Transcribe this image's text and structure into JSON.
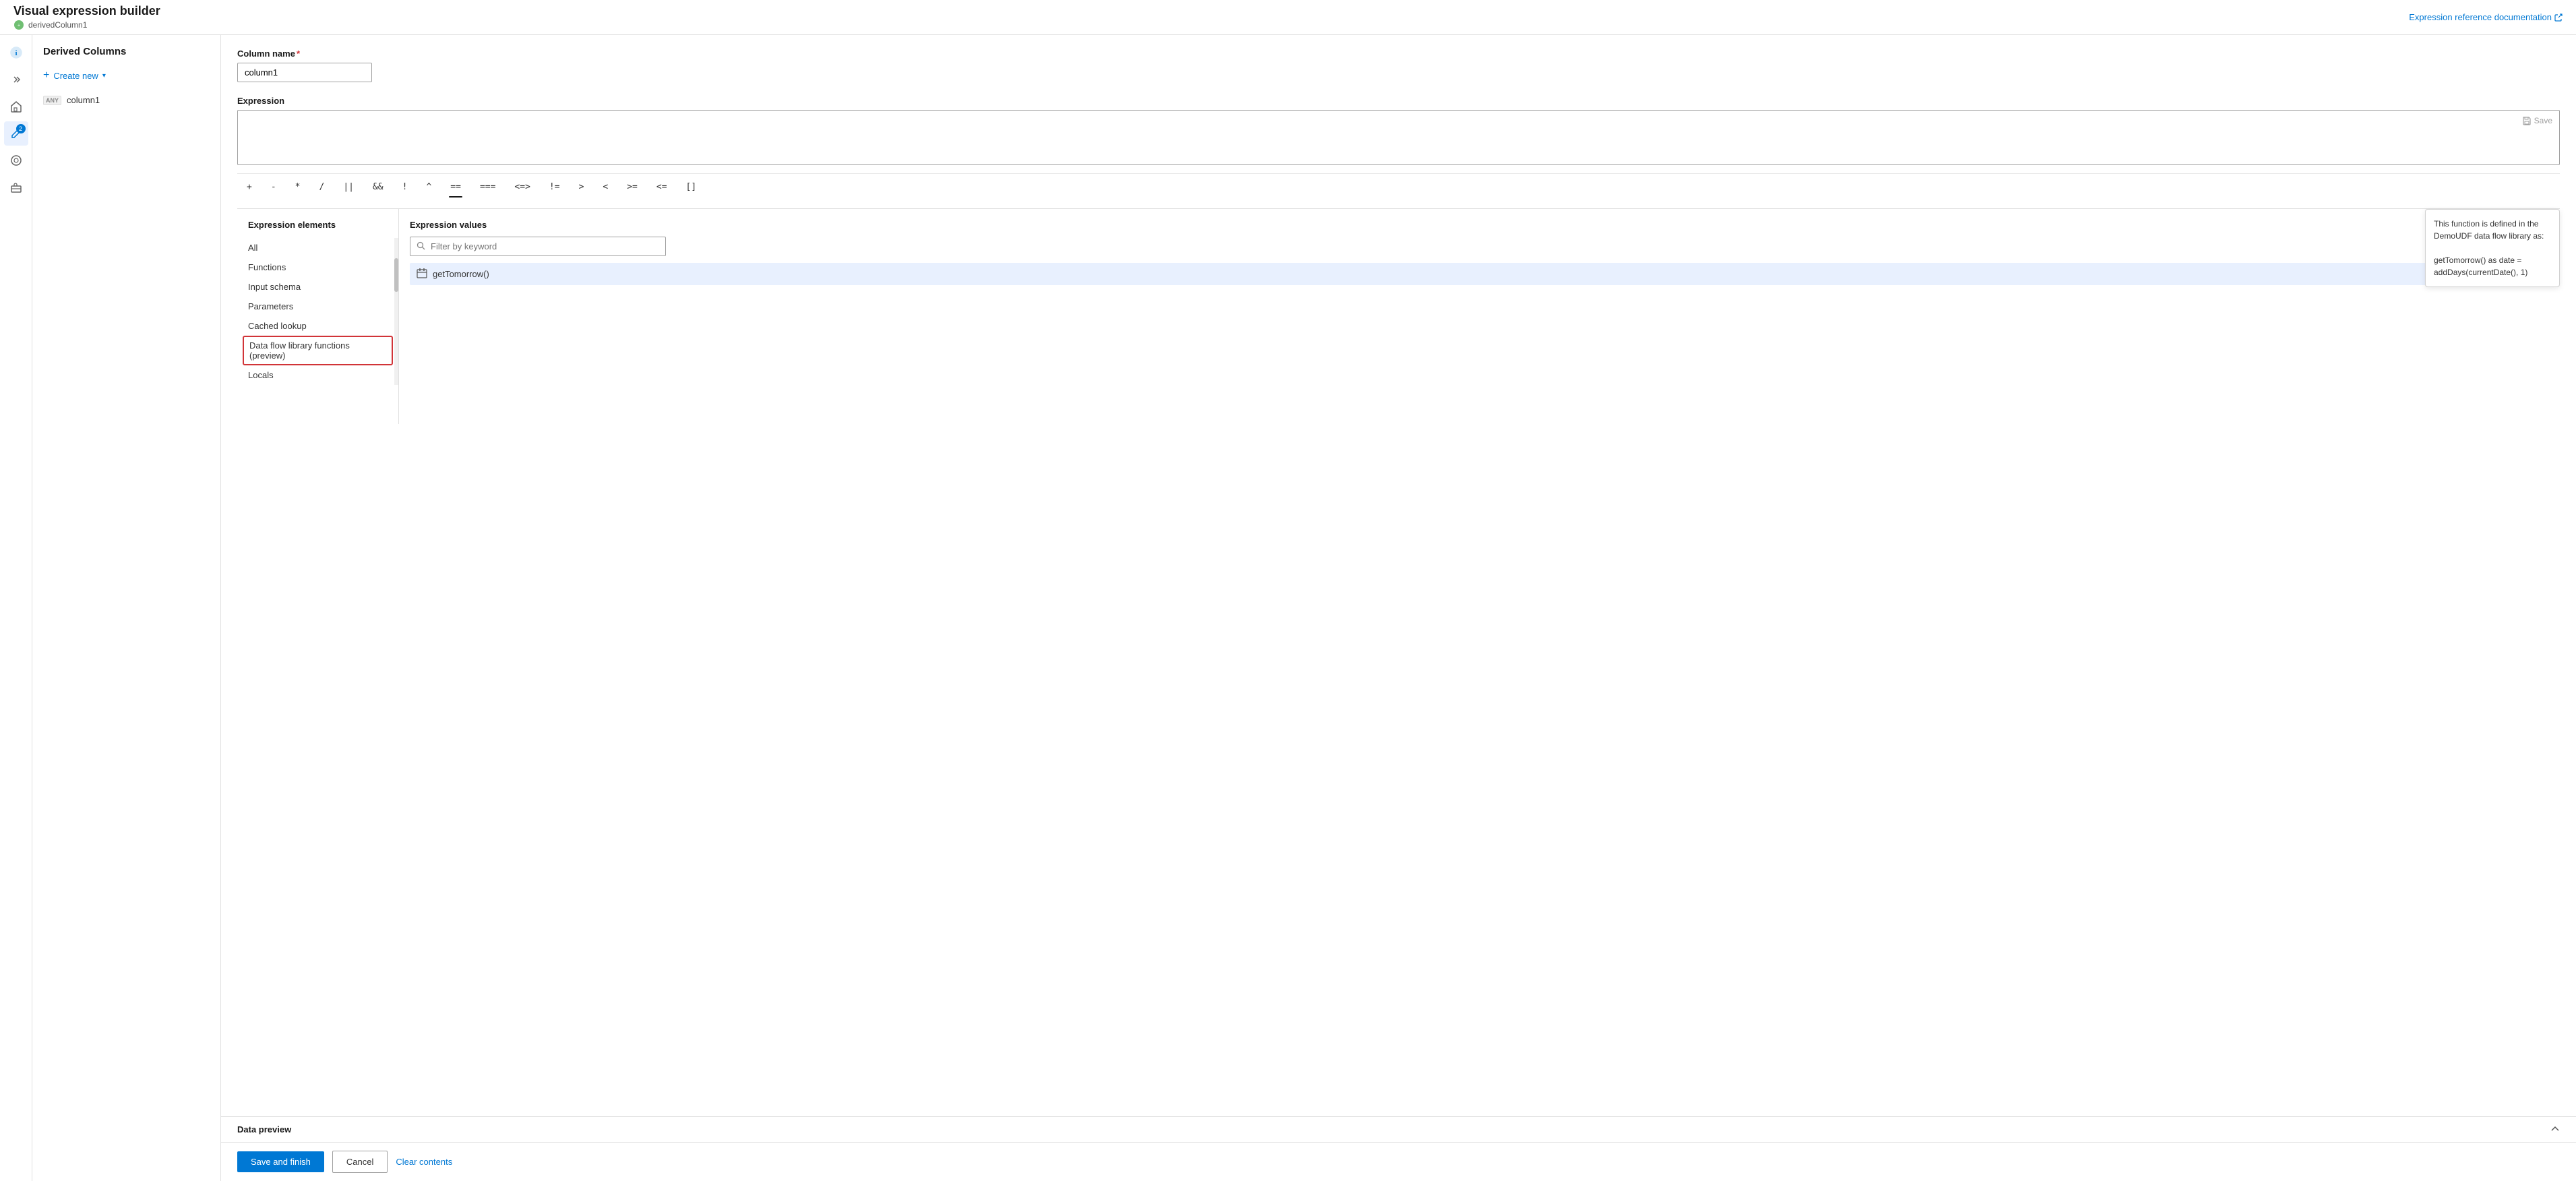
{
  "topbar": {
    "title": "Visual expression builder",
    "subtitle": "derivedColumn1",
    "link_label": "Expression reference documentation",
    "link_icon": "external-link"
  },
  "left_panel": {
    "header": "Derived Columns",
    "create_new_label": "Create new",
    "columns": [
      {
        "name": "column1",
        "type": "ANY"
      }
    ]
  },
  "builder": {
    "column_name_label": "Column name",
    "column_name_required": "*",
    "column_name_value": "column1",
    "expression_label": "Expression",
    "save_label": "Save",
    "operators": [
      "+",
      "-",
      "*",
      "/",
      "||",
      "&&",
      "!",
      "^",
      "==",
      "===",
      "<=>",
      "!=",
      ">",
      "<",
      ">=",
      "<=",
      "[]"
    ],
    "active_operator": "=="
  },
  "expr_elements": {
    "title": "Expression elements",
    "items": [
      {
        "label": "All",
        "highlighted": false
      },
      {
        "label": "Functions",
        "highlighted": false
      },
      {
        "label": "Input schema",
        "highlighted": false
      },
      {
        "label": "Parameters",
        "highlighted": false
      },
      {
        "label": "Cached lookup",
        "highlighted": false
      },
      {
        "label": "Data flow library functions (preview)",
        "highlighted": true
      },
      {
        "label": "Locals",
        "highlighted": false
      }
    ]
  },
  "expr_values": {
    "title": "Expression values",
    "filter_placeholder": "Filter by keyword",
    "items": [
      {
        "label": "getTomorrow()",
        "icon": "calendar"
      }
    ]
  },
  "tooltip": {
    "text": "This function is defined in the DemoUDF data flow library as:\n\ngetTomorrow() as date = addDays(currentDate(), 1)"
  },
  "data_preview": {
    "title": "Data preview",
    "collapse_icon": "chevron-up"
  },
  "bottom_bar": {
    "save_finish_label": "Save and finish",
    "cancel_label": "Cancel",
    "clear_label": "Clear contents"
  }
}
